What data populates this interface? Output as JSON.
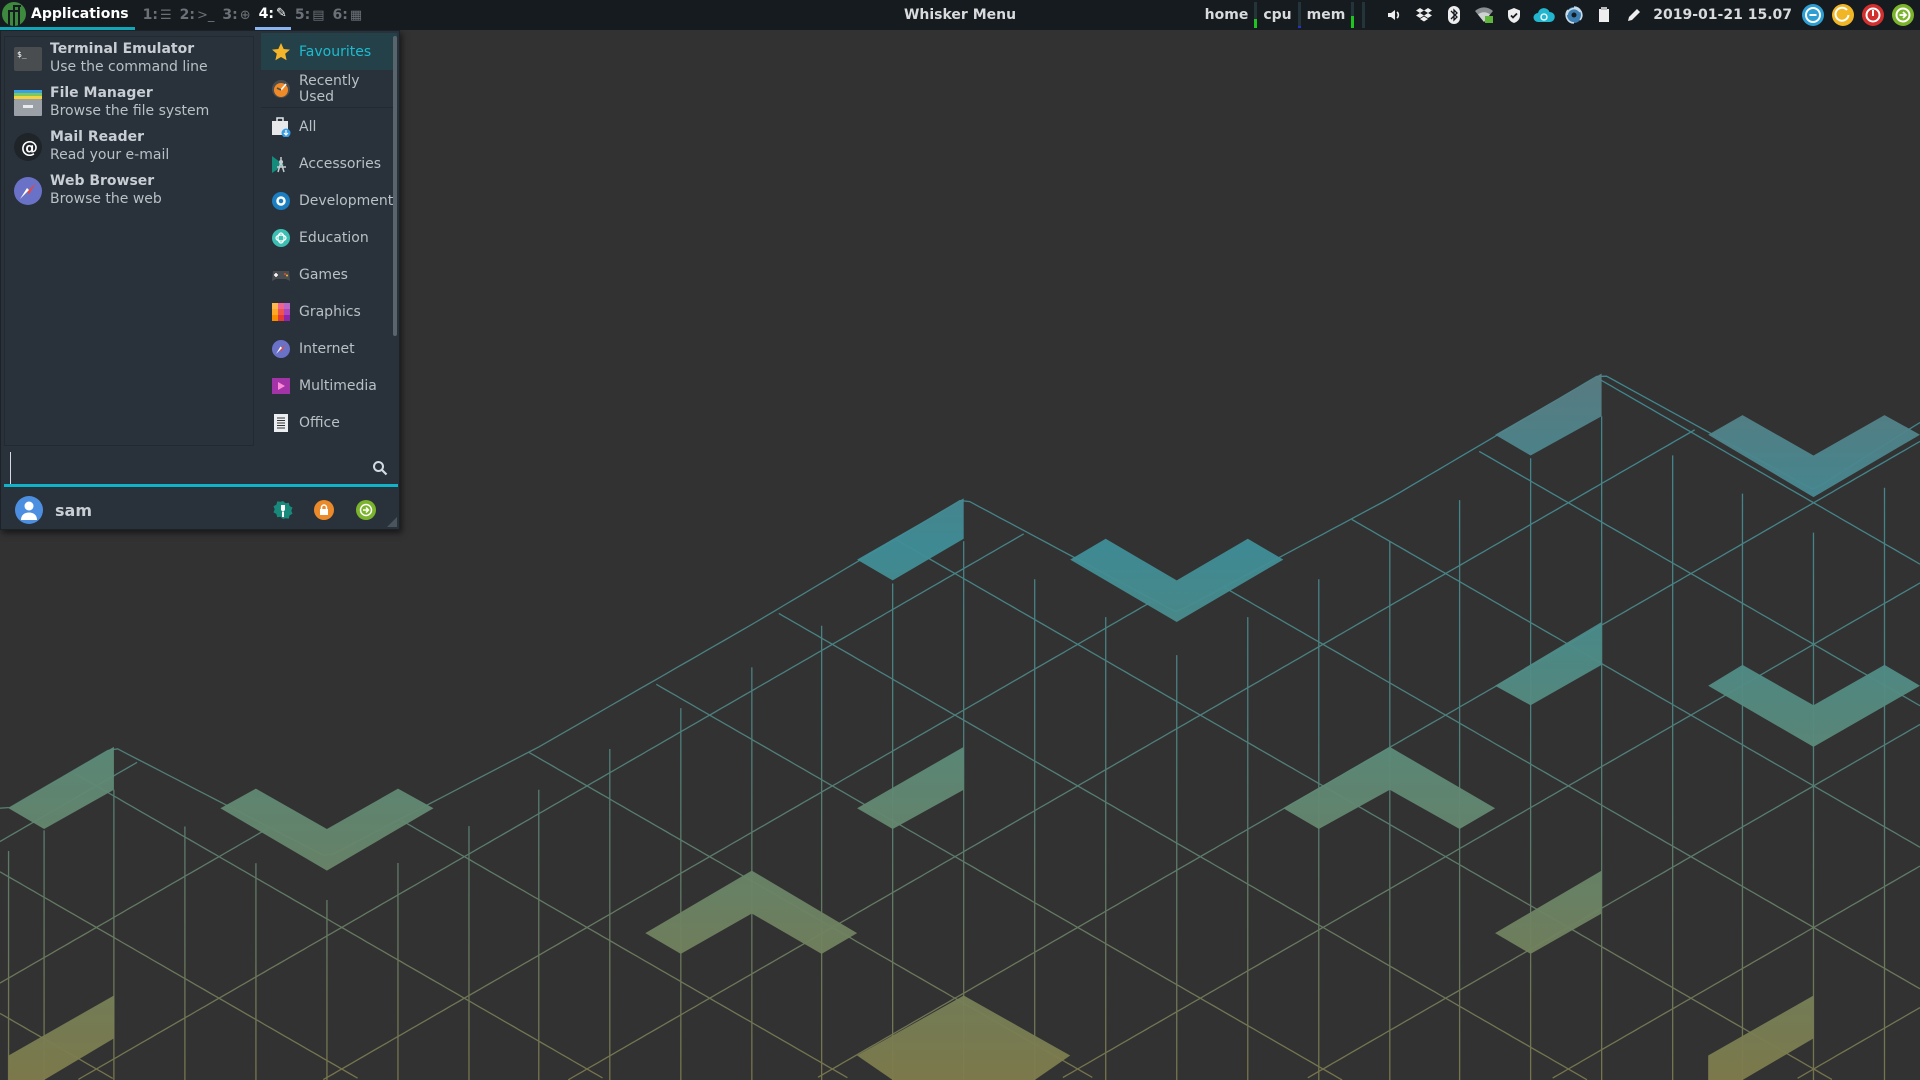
{
  "panel": {
    "applications_label": "Applications",
    "workspaces": [
      {
        "number": "1:",
        "icon": "list-icon",
        "glyph": "☰",
        "active": false
      },
      {
        "number": "2:",
        "icon": "terminal-prompt-icon",
        "glyph": ">_",
        "active": false
      },
      {
        "number": "3:",
        "icon": "globe-icon",
        "glyph": "⊕",
        "active": false
      },
      {
        "number": "4:",
        "icon": "edit-icon",
        "glyph": "✎",
        "active": true
      },
      {
        "number": "5:",
        "icon": "document-icon",
        "glyph": "▤",
        "active": false
      },
      {
        "number": "6:",
        "icon": "calculator-icon",
        "glyph": "▦",
        "active": false
      }
    ],
    "window_title": "Whisker Menu",
    "monitors": [
      {
        "label": "home",
        "fill": 0.35,
        "color": "#1ec51e"
      },
      {
        "label": "cpu",
        "fill": 0.05,
        "color": "#2233cc"
      },
      {
        "label": "mem",
        "fill": 0.45,
        "color": "#1ec51e"
      }
    ],
    "tray_icons": [
      "volume-icon",
      "dropbox-icon",
      "bluetooth-icon",
      "wifi-icon",
      "shield-icon",
      "cloud-sync-icon",
      "steam-icon",
      "clipboard-icon",
      "pencil-icon"
    ],
    "clock": "2019-01-21 15.07",
    "action_buttons": [
      {
        "name": "minimize-all",
        "color": "#2d9fd3"
      },
      {
        "name": "restart",
        "color": "#f0b626"
      },
      {
        "name": "shutdown",
        "color": "#d22f2f"
      },
      {
        "name": "logout",
        "color": "#7bb42c"
      }
    ]
  },
  "menu": {
    "favourites": [
      {
        "name": "Terminal Emulator",
        "desc": "Use the command line"
      },
      {
        "name": "File Manager",
        "desc": "Browse the file system"
      },
      {
        "name": "Mail Reader",
        "desc": "Read your e-mail"
      },
      {
        "name": "Web Browser",
        "desc": "Browse the web"
      }
    ],
    "categories": [
      {
        "label": "Favourites",
        "selected": true
      },
      {
        "label": "Recently Used",
        "selected": false
      },
      {
        "label": "All",
        "selected": false
      },
      {
        "label": "Accessories",
        "selected": false
      },
      {
        "label": "Development",
        "selected": false
      },
      {
        "label": "Education",
        "selected": false
      },
      {
        "label": "Games",
        "selected": false
      },
      {
        "label": "Graphics",
        "selected": false
      },
      {
        "label": "Internet",
        "selected": false
      },
      {
        "label": "Multimedia",
        "selected": false
      },
      {
        "label": "Office",
        "selected": false
      }
    ],
    "search": {
      "value": "",
      "placeholder": ""
    },
    "user": "sam",
    "accent": "#11b3c9"
  }
}
